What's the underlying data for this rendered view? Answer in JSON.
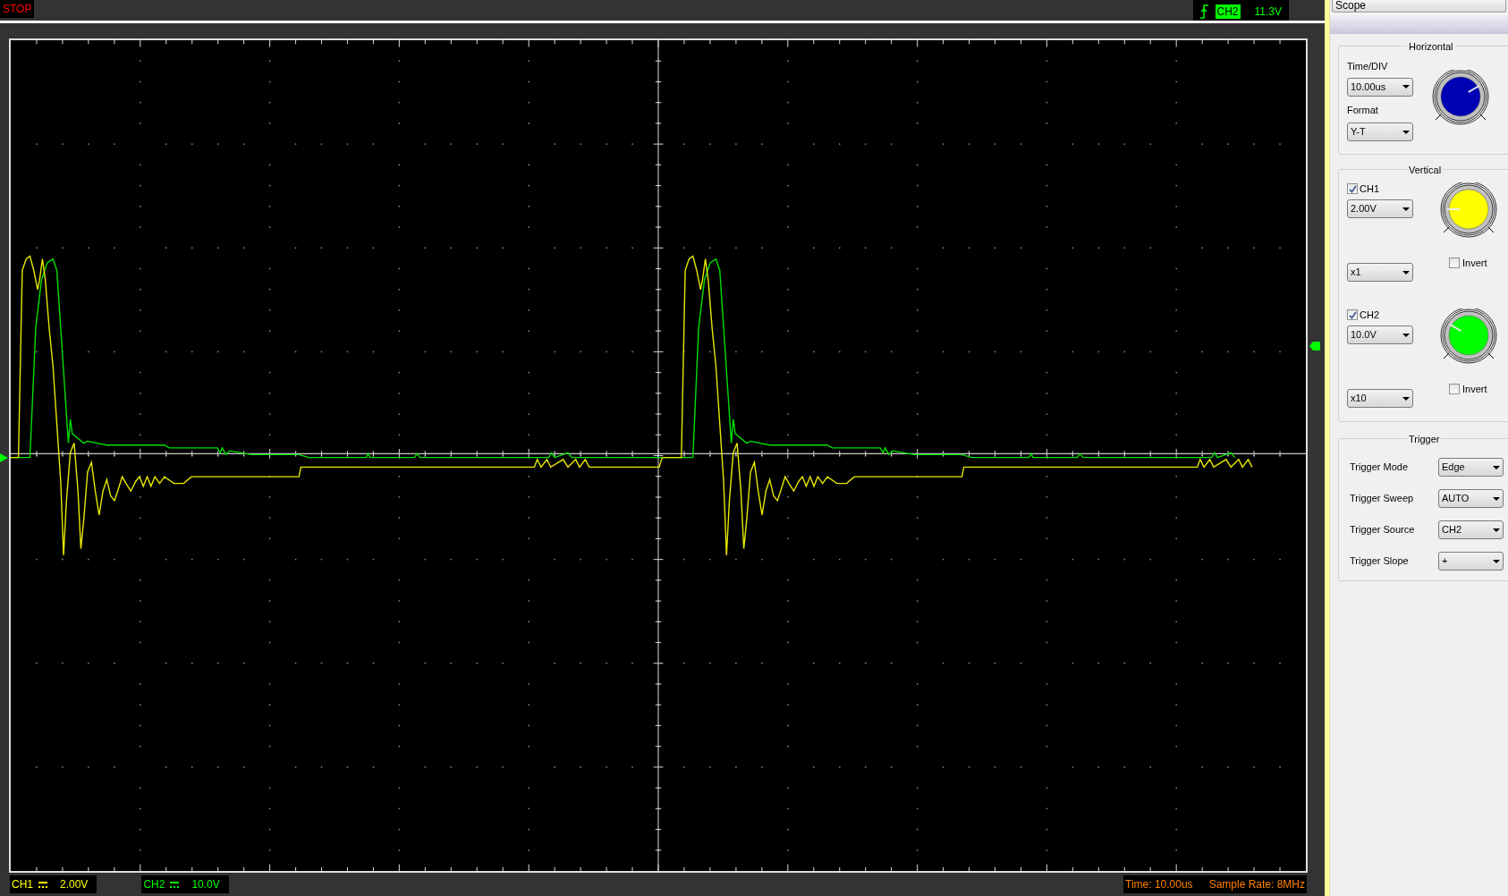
{
  "run_state": "STOP",
  "trigger_readout": {
    "channel": "CH2",
    "voltage": "11.3V"
  },
  "channel_readouts": [
    {
      "label": "CH1",
      "value": "2.00V",
      "color": "#ffff00"
    },
    {
      "label": "CH2",
      "value": "10.0V",
      "color": "#00ff00"
    }
  ],
  "time": "Time: 10.00us",
  "sample_rate": "Sample Rate: 8MHz",
  "panel": {
    "title": "Scope",
    "horizontal": {
      "title": "Horizontal",
      "time_div_label": "Time/DIV",
      "time_div": "10.00us",
      "format_label": "Format",
      "format": "Y-T"
    },
    "vertical": {
      "title": "Vertical",
      "channels": [
        {
          "label": "CH1",
          "checked": true,
          "scale": "2.00V",
          "probe": "x1",
          "invert_label": "Invert",
          "invert": false
        },
        {
          "label": "CH2",
          "checked": true,
          "scale": "10.0V",
          "probe": "x10",
          "invert_label": "Invert",
          "invert": false
        }
      ]
    },
    "trigger": {
      "title": "Trigger",
      "rows": [
        {
          "label": "Trigger Mode",
          "value": "Edge"
        },
        {
          "label": "Trigger Sweep",
          "value": "AUTO"
        },
        {
          "label": "Trigger Source",
          "value": "CH2"
        },
        {
          "label": "Trigger Slope",
          "value": "+"
        }
      ]
    }
  }
}
